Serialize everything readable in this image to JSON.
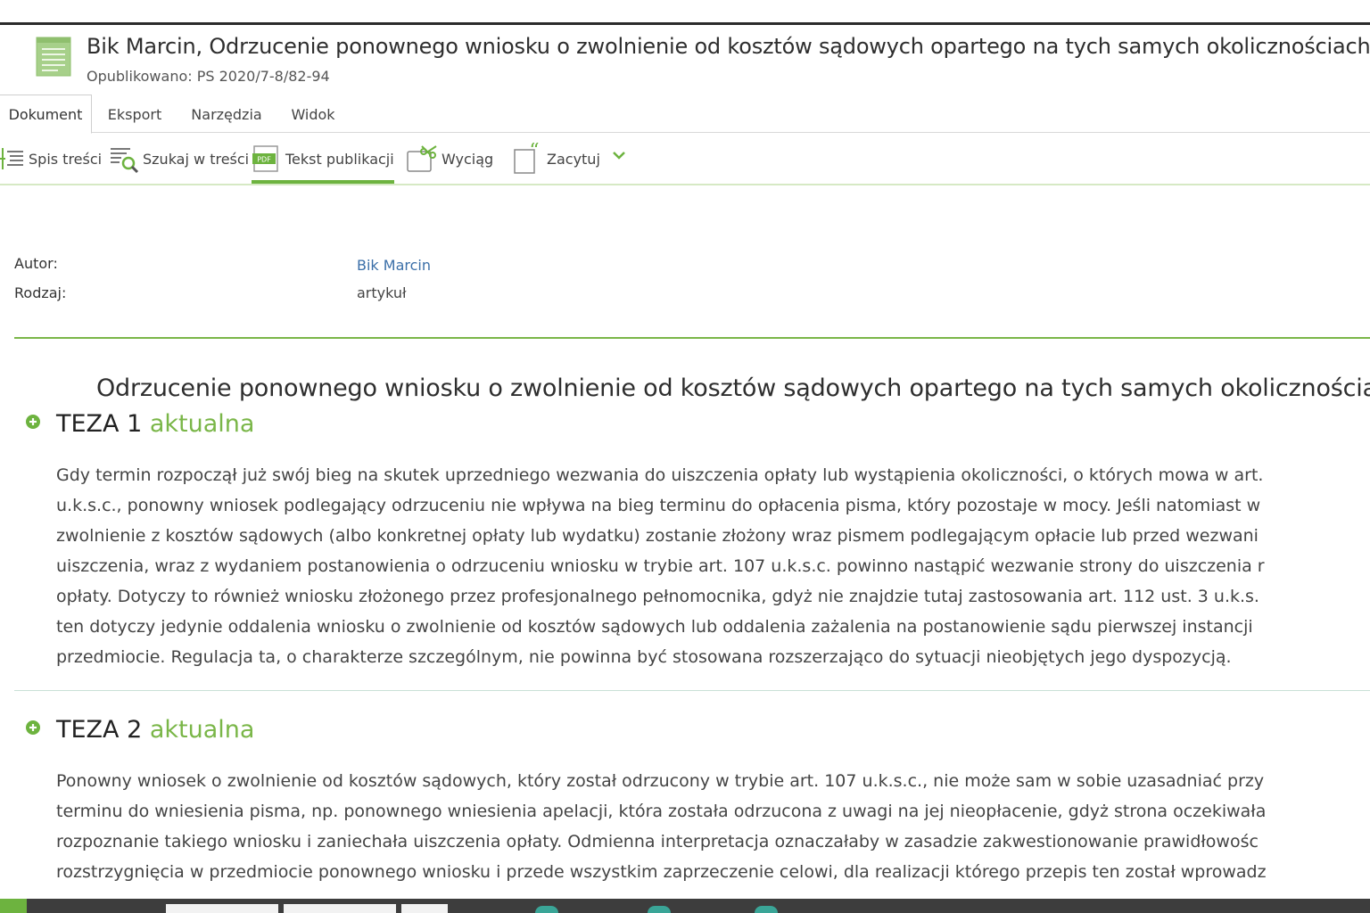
{
  "header": {
    "title": "Bik Marcin, Odrzucenie ponownego wniosku o zwolnienie od kosztów sądowych opartego na tych samych okolicznościach",
    "published": "Opublikowano: PS 2020/7-8/82-94"
  },
  "tabs": [
    {
      "label": "Dokument",
      "active": true
    },
    {
      "label": "Eksport",
      "active": false
    },
    {
      "label": "Narzędzia",
      "active": false
    },
    {
      "label": "Widok",
      "active": false
    }
  ],
  "toolbar": {
    "toc": "Spis treści",
    "search": "Szukaj w treści",
    "publication": "Tekst publikacji",
    "excerpt": "Wyciąg",
    "cite": "Zacytuj",
    "pdf_badge": "PDF"
  },
  "meta": {
    "author_label": "Autor:",
    "author_value": "Bik Marcin",
    "type_label": "Rodzaj:",
    "type_value": "artykuł"
  },
  "article": {
    "heading": "Odrzucenie ponownego wniosku o zwolnienie od kosztów sądowych opartego na tych samych okolicznościach"
  },
  "theses": [
    {
      "number": "TEZA 1",
      "status": "aktualna",
      "lines": [
        "Gdy termin rozpoczął już swój bieg na skutek uprzedniego wezwania do uiszczenia opłaty lub wystąpienia okoliczności, o których mowa w art.",
        "u.k.s.c., ponowny wniosek podlegający odrzuceniu nie wpływa na bieg terminu do opłacenia pisma, który pozostaje w mocy. Jeśli natomiast w",
        "zwolnienie z kosztów sądowych (albo konkretnej opłaty lub wydatku) zostanie złożony wraz pismem podlegającym opłacie lub przed wezwani",
        "uiszczenia, wraz z wydaniem postanowienia o odrzuceniu wniosku w trybie art. 107 u.k.s.c. powinno nastąpić wezwanie strony do uiszczenia r",
        "opłaty. Dotyczy to również wniosku złożonego przez profesjonalnego pełnomocnika, gdyż nie znajdzie tutaj zastosowania art. 112 ust. 3 u.k.s.",
        "ten dotyczy jedynie oddalenia wniosku o zwolnienie od kosztów sądowych lub oddalenia zażalenia na postanowienie sądu pierwszej instancji",
        "przedmiocie. Regulacja ta, o charakterze szczególnym, nie powinna być stosowana rozszerzająco do sytuacji nieobjętych jego dyspozycją."
      ]
    },
    {
      "number": "TEZA 2",
      "status": "aktualna",
      "lines": [
        "Ponowny wniosek o zwolnienie od kosztów sądowych, który został odrzucony w trybie art. 107 u.k.s.c., nie może sam w sobie uzasadniać przy",
        "terminu do wniesienia pisma, np. ponownego wniesienia apelacji, która została odrzucona z uwagi na jej nieopłacenie, gdyż strona oczekiwała",
        "rozpoznanie takiego wniosku i zaniechała uiszczenia opłaty. Odmienna interpretacja oznaczałaby w zasadzie zakwestionowanie prawidłowośc",
        "rozstrzygnięcia w przedmiocie ponownego wniosku i przede wszystkim zaprzeczenie celowi, dla realizacji którego przepis ten został wprowadz"
      ]
    }
  ],
  "colors": {
    "accent_green": "#7ab648",
    "link_blue": "#3b6fa8",
    "bottom_bar": "#3d3d3d"
  }
}
